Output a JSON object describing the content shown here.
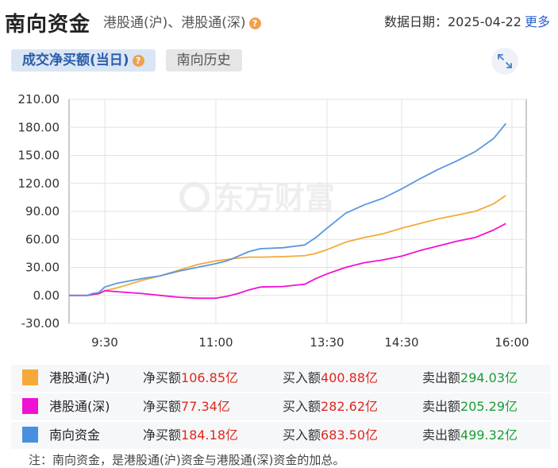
{
  "header": {
    "title": "南向资金",
    "subtitle": "港股通(沪)、港股通(深)",
    "date_label": "数据日期：2025-04-22",
    "more_label": "更多"
  },
  "tabs": [
    {
      "label": "成交净买额(当日)",
      "active": true
    },
    {
      "label": "南向历史",
      "active": false
    }
  ],
  "chart_data": {
    "type": "line",
    "title": "",
    "xlabel": "",
    "ylabel": "",
    "x_ticks": [
      "9:30",
      "11:00",
      "13:30",
      "14:30",
      "16:00"
    ],
    "y_ticks": [
      "210.00",
      "180.00",
      "150.00",
      "120.00",
      "90.00",
      "60.00",
      "30.00",
      "0.00",
      "-30.00"
    ],
    "ylim": [
      -30,
      210
    ],
    "grid": true,
    "watermark": "东方财富",
    "series": [
      {
        "name": "港股通(沪)",
        "color": "#f5a93b",
        "points": [
          [
            "9:00",
            0
          ],
          [
            "9:15",
            0
          ],
          [
            "9:20",
            1
          ],
          [
            "9:25",
            1.5
          ],
          [
            "9:30",
            5
          ],
          [
            "9:40",
            8
          ],
          [
            "10:00",
            16
          ],
          [
            "10:15",
            21
          ],
          [
            "10:30",
            27
          ],
          [
            "10:45",
            33
          ],
          [
            "11:00",
            37
          ],
          [
            "11:15",
            38.5
          ],
          [
            "11:30",
            40
          ],
          [
            "11:45",
            41
          ],
          [
            "12:00",
            41
          ],
          [
            "12:30",
            41.5
          ],
          [
            "13:00",
            42.5
          ],
          [
            "13:15",
            45
          ],
          [
            "13:30",
            49
          ],
          [
            "13:45",
            57
          ],
          [
            "14:00",
            62
          ],
          [
            "14:15",
            66
          ],
          [
            "14:30",
            72
          ],
          [
            "14:45",
            77
          ],
          [
            "15:00",
            82
          ],
          [
            "15:15",
            86
          ],
          [
            "15:30",
            90
          ],
          [
            "15:45",
            98
          ],
          [
            "15:55",
            107
          ]
        ]
      },
      {
        "name": "港股通(深)",
        "color": "#f011d2",
        "points": [
          [
            "9:00",
            0
          ],
          [
            "9:15",
            0
          ],
          [
            "9:20",
            1
          ],
          [
            "9:25",
            2
          ],
          [
            "9:30",
            5
          ],
          [
            "9:40",
            4
          ],
          [
            "10:00",
            2
          ],
          [
            "10:15",
            0
          ],
          [
            "10:30",
            -2
          ],
          [
            "10:45",
            -3
          ],
          [
            "11:00",
            -3
          ],
          [
            "11:15",
            -1
          ],
          [
            "11:30",
            2
          ],
          [
            "11:45",
            6
          ],
          [
            "12:00",
            9
          ],
          [
            "12:30",
            9.5
          ],
          [
            "13:00",
            12
          ],
          [
            "13:15",
            18
          ],
          [
            "13:30",
            23
          ],
          [
            "13:45",
            30
          ],
          [
            "14:00",
            35
          ],
          [
            "14:15",
            38
          ],
          [
            "14:30",
            42
          ],
          [
            "14:45",
            48
          ],
          [
            "15:00",
            53
          ],
          [
            "15:15",
            58
          ],
          [
            "15:30",
            62
          ],
          [
            "15:45",
            70
          ],
          [
            "15:55",
            77
          ]
        ]
      },
      {
        "name": "南向资金",
        "color": "#5b97e0",
        "points": [
          [
            "9:00",
            0
          ],
          [
            "9:15",
            0
          ],
          [
            "9:20",
            2
          ],
          [
            "9:25",
            3
          ],
          [
            "9:30",
            9
          ],
          [
            "9:40",
            13
          ],
          [
            "10:00",
            18
          ],
          [
            "10:15",
            21
          ],
          [
            "10:30",
            26
          ],
          [
            "10:45",
            30
          ],
          [
            "11:00",
            34
          ],
          [
            "11:15",
            37
          ],
          [
            "11:30",
            42
          ],
          [
            "11:45",
            47
          ],
          [
            "12:00",
            50
          ],
          [
            "12:30",
            51
          ],
          [
            "13:00",
            54
          ],
          [
            "13:15",
            62
          ],
          [
            "13:30",
            72
          ],
          [
            "13:45",
            88
          ],
          [
            "14:00",
            97
          ],
          [
            "14:15",
            104
          ],
          [
            "14:30",
            114
          ],
          [
            "14:45",
            125
          ],
          [
            "15:00",
            135
          ],
          [
            "15:15",
            144
          ],
          [
            "15:30",
            154
          ],
          [
            "15:45",
            168
          ],
          [
            "15:55",
            184
          ]
        ]
      }
    ]
  },
  "legend": [
    {
      "name": "港股通(沪)",
      "color": "#f5a93b",
      "net_label": "净买额",
      "net": "106.85亿",
      "buy_label": "买入额",
      "buy": "400.88亿",
      "sell_label": "卖出额",
      "sell": "294.03亿"
    },
    {
      "name": "港股通(深)",
      "color": "#f011d2",
      "net_label": "净买额",
      "net": "77.34亿",
      "buy_label": "买入额",
      "buy": "282.62亿",
      "sell_label": "卖出额",
      "sell": "205.29亿"
    },
    {
      "name": "南向资金",
      "color": "#4a8ee0",
      "net_label": "净买额",
      "net": "184.18亿",
      "buy_label": "买入额",
      "buy": "683.50亿",
      "sell_label": "卖出额",
      "sell": "499.32亿"
    }
  ],
  "note": "注：南向资金，是港股通(沪)资金与港股通(深)资金的加总。",
  "icons": {
    "help": "help-icon",
    "expand": "expand-icon"
  }
}
